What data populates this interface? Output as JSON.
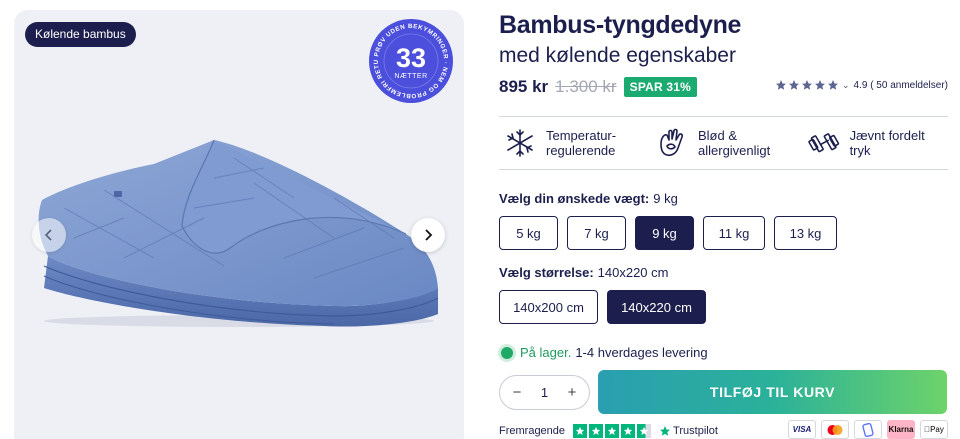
{
  "gallery": {
    "tag": "Kølende bambus",
    "badge": {
      "number": "33",
      "unit": "NÆTTER",
      "ring_text": "PRØV UDEN BEKYMRINGER · NEM OG PROBLEMFRI RETUR ·"
    },
    "prev_icon": "chevron-left-icon",
    "next_icon": "chevron-right-icon",
    "image": "weighted-blanket-blue",
    "badge_color": "#4b4fdc"
  },
  "product": {
    "title": "Bambus-tyngdedyne",
    "subtitle": "med kølende egenskaber",
    "price": "895 kr",
    "old_price": "1.300 kr",
    "discount": "SPAR 31%",
    "rating_value": "4.9",
    "rating_count": "( 50 anmeldelser)",
    "rating_stars": 5
  },
  "features": [
    {
      "icon": "snowflake-sun-icon",
      "label": "Temperatur-\nregulerende"
    },
    {
      "icon": "hand-leaf-icon",
      "label": "Blød &\nallergivenligt"
    },
    {
      "icon": "dumbbell-icon",
      "label": "Jævnt fordelt tryk"
    }
  ],
  "weight": {
    "label": "Vælg din ønskede vægt:",
    "selected": "9 kg",
    "options": [
      "5 kg",
      "7 kg",
      "9 kg",
      "11 kg",
      "13 kg"
    ]
  },
  "size": {
    "label": "Vælg størrelse:",
    "selected": "140x220 cm",
    "options": [
      "140x200 cm",
      "140x220 cm"
    ]
  },
  "stock": {
    "status": "På lager.",
    "delivery": "1-4 hverdages levering"
  },
  "cart": {
    "quantity": "1",
    "minus": "−",
    "plus": "+",
    "button": "TILFØJ TIL KURV"
  },
  "trust": {
    "rating_word": "Fremragende",
    "brand": "Trustpilot"
  },
  "payments": [
    "VISA",
    "Mastercard",
    "MobilePay",
    "Klarna",
    "Pay"
  ],
  "colors": {
    "navy": "#1c1f4d",
    "green": "#1bab70",
    "trustpilot": "#00b67a",
    "klarna": "#ffb3c7"
  }
}
